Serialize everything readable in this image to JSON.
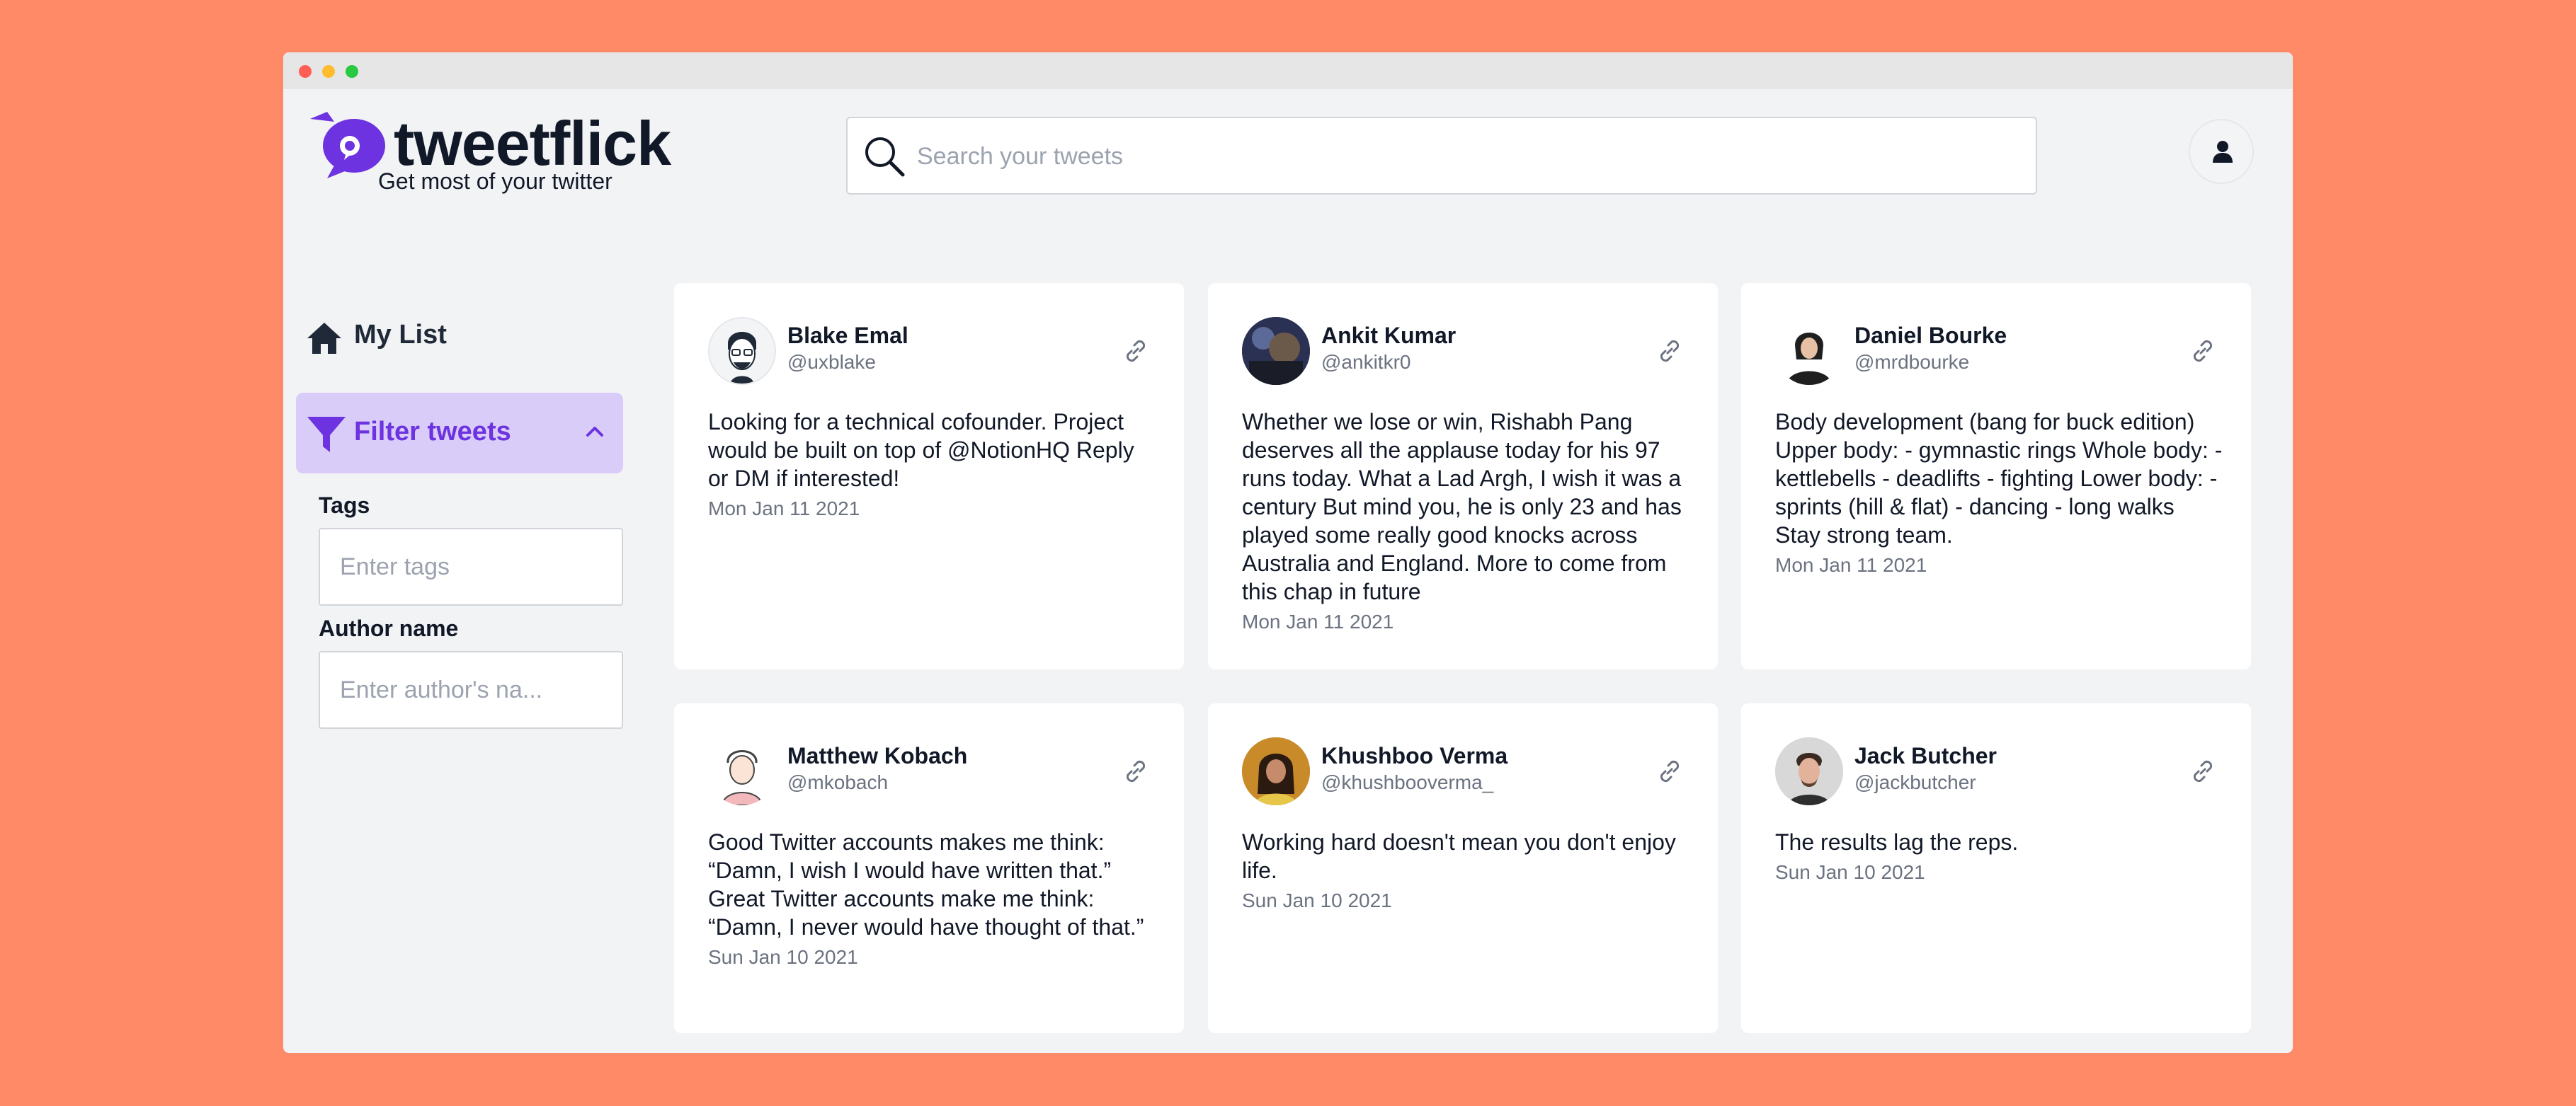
{
  "app": {
    "name": "tweetflick",
    "tagline": "Get most of your twitter"
  },
  "search": {
    "placeholder": "Search your tweets"
  },
  "sidebar": {
    "my_list": "My List",
    "filter": "Filter tweets",
    "tags_label": "Tags",
    "tags_placeholder": "Enter tags",
    "author_label": "Author name",
    "author_placeholder": "Enter author's na..."
  },
  "colors": {
    "background": "#FF8A68",
    "accent": "#6D33E0",
    "accent_light": "#D9CCF8"
  },
  "tweets": [
    {
      "name": "Blake Emal",
      "handle": "@uxblake",
      "text": "Looking for a technical cofounder. Project would be built on top of @NotionHQ Reply or DM if interested!",
      "date": "Mon Jan 11 2021"
    },
    {
      "name": "Ankit Kumar",
      "handle": "@ankitkr0",
      "text": "Whether we lose or win, Rishabh Pang deserves all the applause today for his 97 runs today. What a Lad Argh, I wish it was a century But mind you, he is only 23 and has played some really good knocks across Australia and England. More to come from this chap in future",
      "date": "Mon Jan 11 2021"
    },
    {
      "name": "Daniel Bourke",
      "handle": "@mrdbourke",
      "text": "Body development (bang for buck edition) Upper body: - gymnastic rings Whole body: - kettlebells - deadlifts - fighting Lower body: - sprints (hill & flat) - dancing - long walks Stay strong team.",
      "date": "Mon Jan 11 2021"
    },
    {
      "name": "Matthew Kobach",
      "handle": "@mkobach",
      "text": "Good Twitter accounts makes me think: “Damn, I wish I would have written that.” Great Twitter accounts make me think: “Damn, I never would have thought of that.”",
      "date": "Sun Jan 10 2021"
    },
    {
      "name": "Khushboo Verma",
      "handle": "@khushbooverma_",
      "text": "Working hard doesn't mean you don't enjoy life.",
      "date": "Sun Jan 10 2021"
    },
    {
      "name": "Jack Butcher",
      "handle": "@jackbutcher",
      "text": "The results lag the reps.",
      "date": "Sun Jan 10 2021"
    }
  ]
}
